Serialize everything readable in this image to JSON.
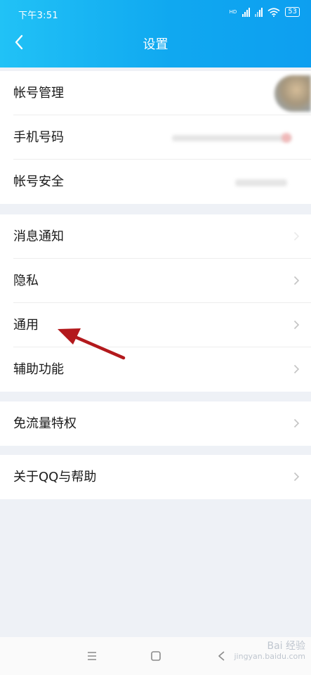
{
  "status_bar": {
    "time": "下午3:51",
    "network_badge": "HD",
    "battery": "53"
  },
  "header": {
    "title": "设置",
    "back_icon": "chevron-left-icon"
  },
  "groups": [
    {
      "items": [
        {
          "label": "帐号管理"
        },
        {
          "label": "手机号码"
        },
        {
          "label": "帐号安全"
        }
      ]
    },
    {
      "items": [
        {
          "label": "消息通知"
        },
        {
          "label": "隐私"
        },
        {
          "label": "通用"
        },
        {
          "label": "辅助功能"
        }
      ]
    },
    {
      "items": [
        {
          "label": "免流量特权"
        }
      ]
    },
    {
      "items": [
        {
          "label": "关于QQ与帮助"
        }
      ]
    }
  ],
  "annotation": {
    "arrow_color": "#b3191c",
    "points_to": "通用"
  },
  "bottom_nav": {
    "icons": [
      "menu-icon",
      "home-square-icon",
      "back-triangle-icon"
    ]
  },
  "watermark": {
    "line1": "Bai 经验",
    "line2": "jingyan.baidu.com"
  },
  "colors": {
    "header_start": "#21c2f6",
    "header_end": "#0d9ff0",
    "background": "#eef1f6"
  }
}
